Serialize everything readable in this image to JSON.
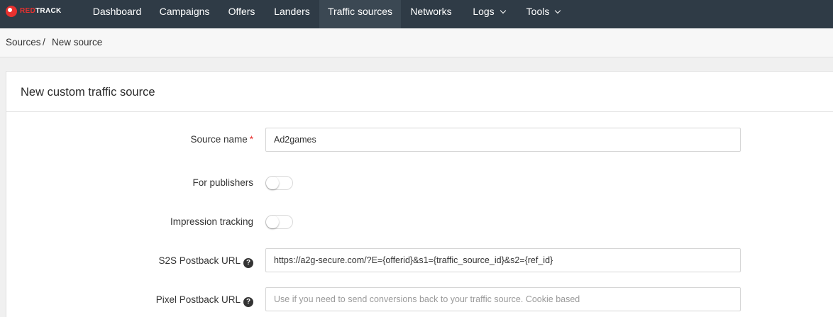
{
  "logo": {
    "part1": "RED",
    "part2": "TRACK"
  },
  "nav": {
    "items": [
      {
        "label": "Dashboard"
      },
      {
        "label": "Campaigns"
      },
      {
        "label": "Offers"
      },
      {
        "label": "Landers"
      },
      {
        "label": "Traffic sources",
        "active": true
      },
      {
        "label": "Networks"
      },
      {
        "label": "Logs",
        "dropdown": true
      },
      {
        "label": "Tools",
        "dropdown": true
      }
    ]
  },
  "breadcrumb": {
    "parent": "Sources",
    "separator": "/",
    "current": "New source"
  },
  "form": {
    "title": "New custom traffic source",
    "source_name": {
      "label": "Source name",
      "required_mark": "*",
      "value": "Ad2games"
    },
    "for_publishers": {
      "label": "For publishers",
      "enabled": false
    },
    "impression_tracking": {
      "label": "Impression tracking",
      "enabled": false
    },
    "s2s_postback": {
      "label": "S2S Postback URL",
      "help": "?",
      "value": "https://a2g-secure.com/?E={offerid}&s1={traffic_source_id}&s2={ref_id}"
    },
    "pixel_postback": {
      "label": "Pixel Postback URL",
      "help": "?",
      "value": "",
      "placeholder": "Use if you need to send conversions back to your traffic source. Cookie based"
    }
  },
  "colors": {
    "nav_bg": "#2f3b46",
    "nav_active_bg": "#3b4853",
    "brand_red": "#e8312f"
  }
}
